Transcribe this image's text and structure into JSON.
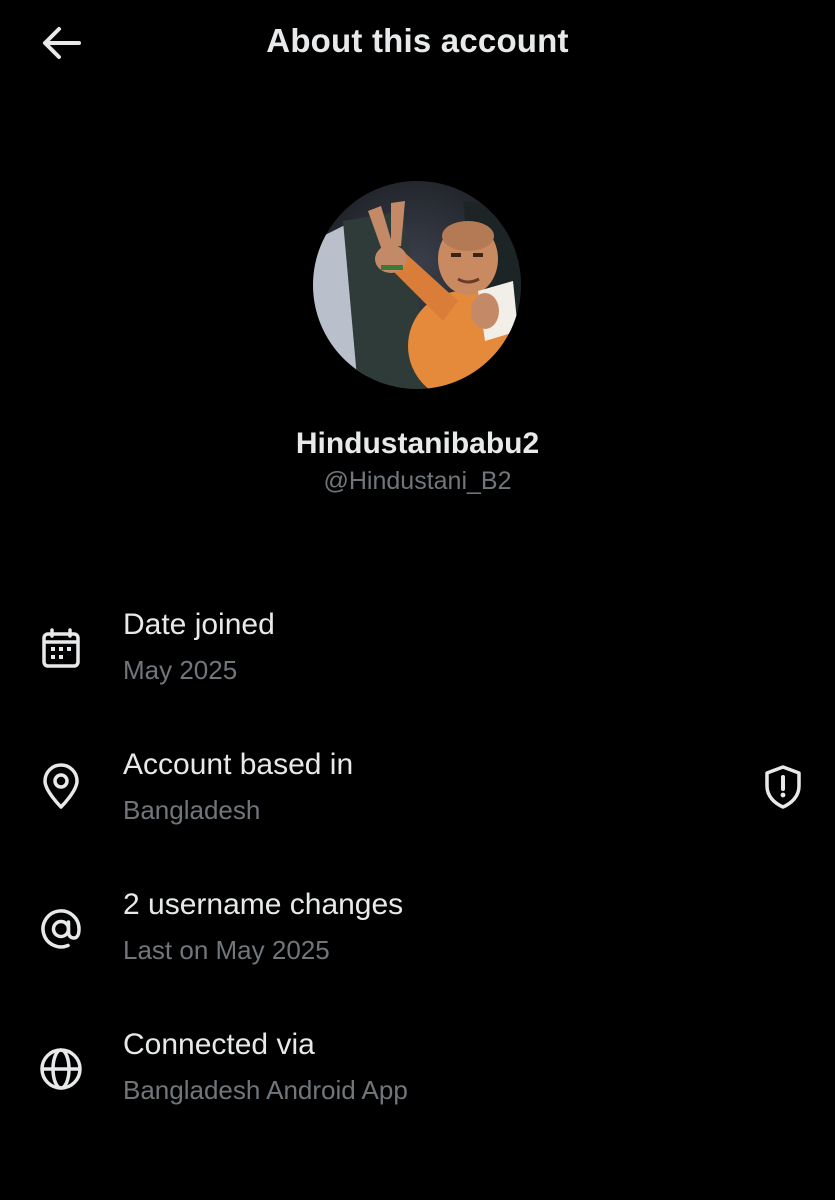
{
  "header": {
    "title": "About this account",
    "back_icon": "arrow-left-icon"
  },
  "profile": {
    "display_name": "Hindustanibabu2",
    "handle": "@Hindustani_B2"
  },
  "rows": [
    {
      "icon": "calendar-icon",
      "label": "Date joined",
      "value": "May 2025"
    },
    {
      "icon": "location-pin-icon",
      "label": "Account based in",
      "value": "Bangladesh",
      "trailing_icon": "shield-alert-icon"
    },
    {
      "icon": "at-sign-icon",
      "label": "2 username changes",
      "value": "Last on May 2025"
    },
    {
      "icon": "globe-icon",
      "label": "Connected via",
      "value": "Bangladesh Android App"
    }
  ],
  "colors": {
    "background": "#000000",
    "primary_text": "#e7e9ea",
    "secondary_text": "#71767b"
  }
}
